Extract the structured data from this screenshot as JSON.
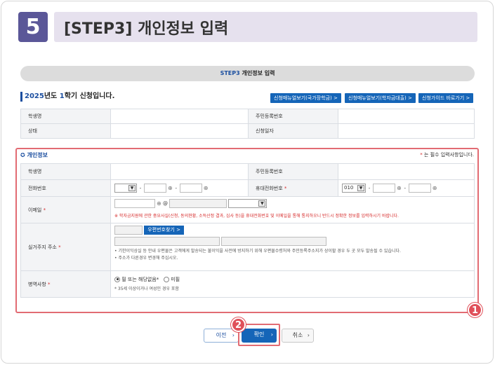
{
  "header": {
    "step_number": "5",
    "step_title": "[STEP3] 개인정보 입력"
  },
  "step_pill": {
    "prefix": "STEP3",
    "text": "개인정보 입력"
  },
  "semester": {
    "year": "2025",
    "suffix1": "년도 ",
    "term": "1",
    "suffix2": "학기 신청입니다."
  },
  "top_buttons": [
    "신청매뉴얼보기(국가장학금) >",
    "신청매뉴얼보기(학자금대출) >",
    "신청가이드 바로가기 >"
  ],
  "info_table": {
    "student_name_label": "학생명",
    "resident_no_label": "주민등록번호",
    "status_label": "상태",
    "apply_date_label": "신청일자"
  },
  "personal_section": {
    "title": "개인정보",
    "required_note": "는 필수 입력사항입니다.",
    "required_mark": "*"
  },
  "form": {
    "student_name_label": "학생명",
    "resident_no_label": "주민등록번호",
    "phone_label": "전화번호",
    "mobile_label": "휴대전화번호",
    "mobile_prefix": "010",
    "email_label": "이메일",
    "email_at": "@",
    "email_warning": "※ 학자금지원에 관한 중요사실(신청, 동의현황, 소득산정 결과, 심사 등)을 휴대전화번호 및 이메일을 통해 통지하오니 반드시 정확한 정보를 입력하시기 바랍니다.",
    "address_label": "실거주지 주소",
    "zip_button": "우편번호찾기 >",
    "address_note1": "• 기한이익상실 등 안내 우편물은 고객에게 발송되는 불이익을 사전에 방지하기 위해 우편물수령처와 주민등록주소지가 상이할 경우 두 곳 모두 발송될 수 있습니다.",
    "address_note2": "• 주소가 다른경우 변경해 주십시오.",
    "military_label": "병역사항",
    "military_opt1": "필 또는 해당없음*",
    "military_opt2": "미필",
    "military_note": "* 35세 이상이거나 여성인 경우 포함"
  },
  "annotations": {
    "one": "1",
    "two": "2"
  },
  "bottom_buttons": {
    "prev": "이전",
    "confirm": "확인",
    "cancel": "취소"
  }
}
